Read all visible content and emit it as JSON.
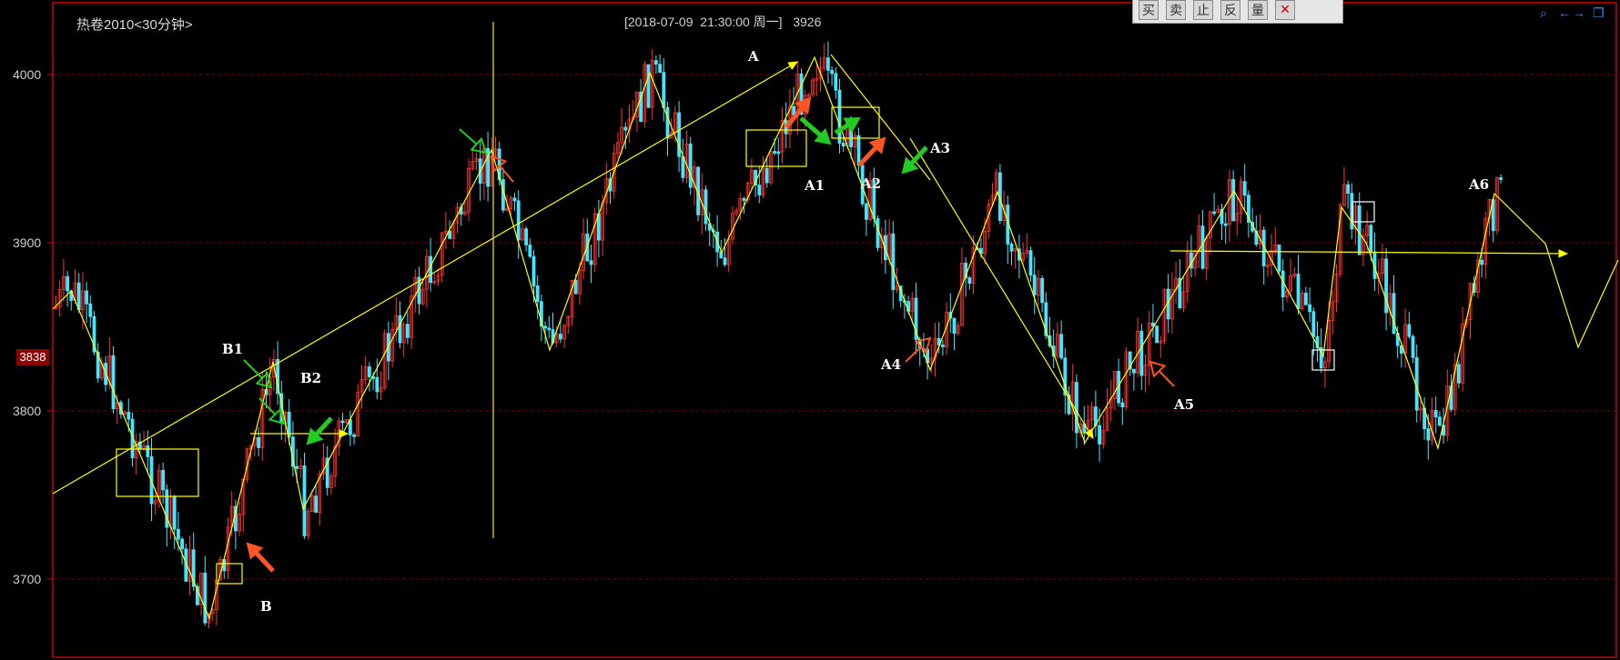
{
  "header": {
    "title": "热卷2010<30分钟>",
    "datetime": "[2018-07-09  21:30:00 周一]",
    "value": "3926"
  },
  "toolbar": {
    "buttons": [
      {
        "label": "买",
        "icon": "buy"
      },
      {
        "label": "卖",
        "icon": "sell"
      },
      {
        "label": "止",
        "icon": "stop"
      },
      {
        "label": "反",
        "icon": "reverse"
      },
      {
        "label": "量",
        "icon": "volume"
      },
      {
        "label": "✕",
        "icon": "close-icon"
      }
    ]
  },
  "top_right_icons": [
    "zoom-icon",
    "arrow-left-icon",
    "arrow-right-icon",
    "restore-icon"
  ],
  "current_price_badge": "3838",
  "colors": {
    "up": "#ff3333",
    "down": "#44e6ff",
    "trendline": "#ffff00",
    "axis": "#cc0000",
    "grid": "#880000",
    "label": "#ffffff",
    "arrow_green": "#22cc22",
    "arrow_orange": "#ff5522"
  },
  "chart_data": {
    "type": "candlestick",
    "yticks": [
      4000,
      3900,
      3800,
      3700
    ],
    "ylim": [
      3640,
      4045
    ],
    "wave_points": [
      "A",
      "B",
      "B1",
      "B2",
      "A1",
      "A2",
      "A3",
      "A4",
      "A5",
      "A6"
    ]
  }
}
